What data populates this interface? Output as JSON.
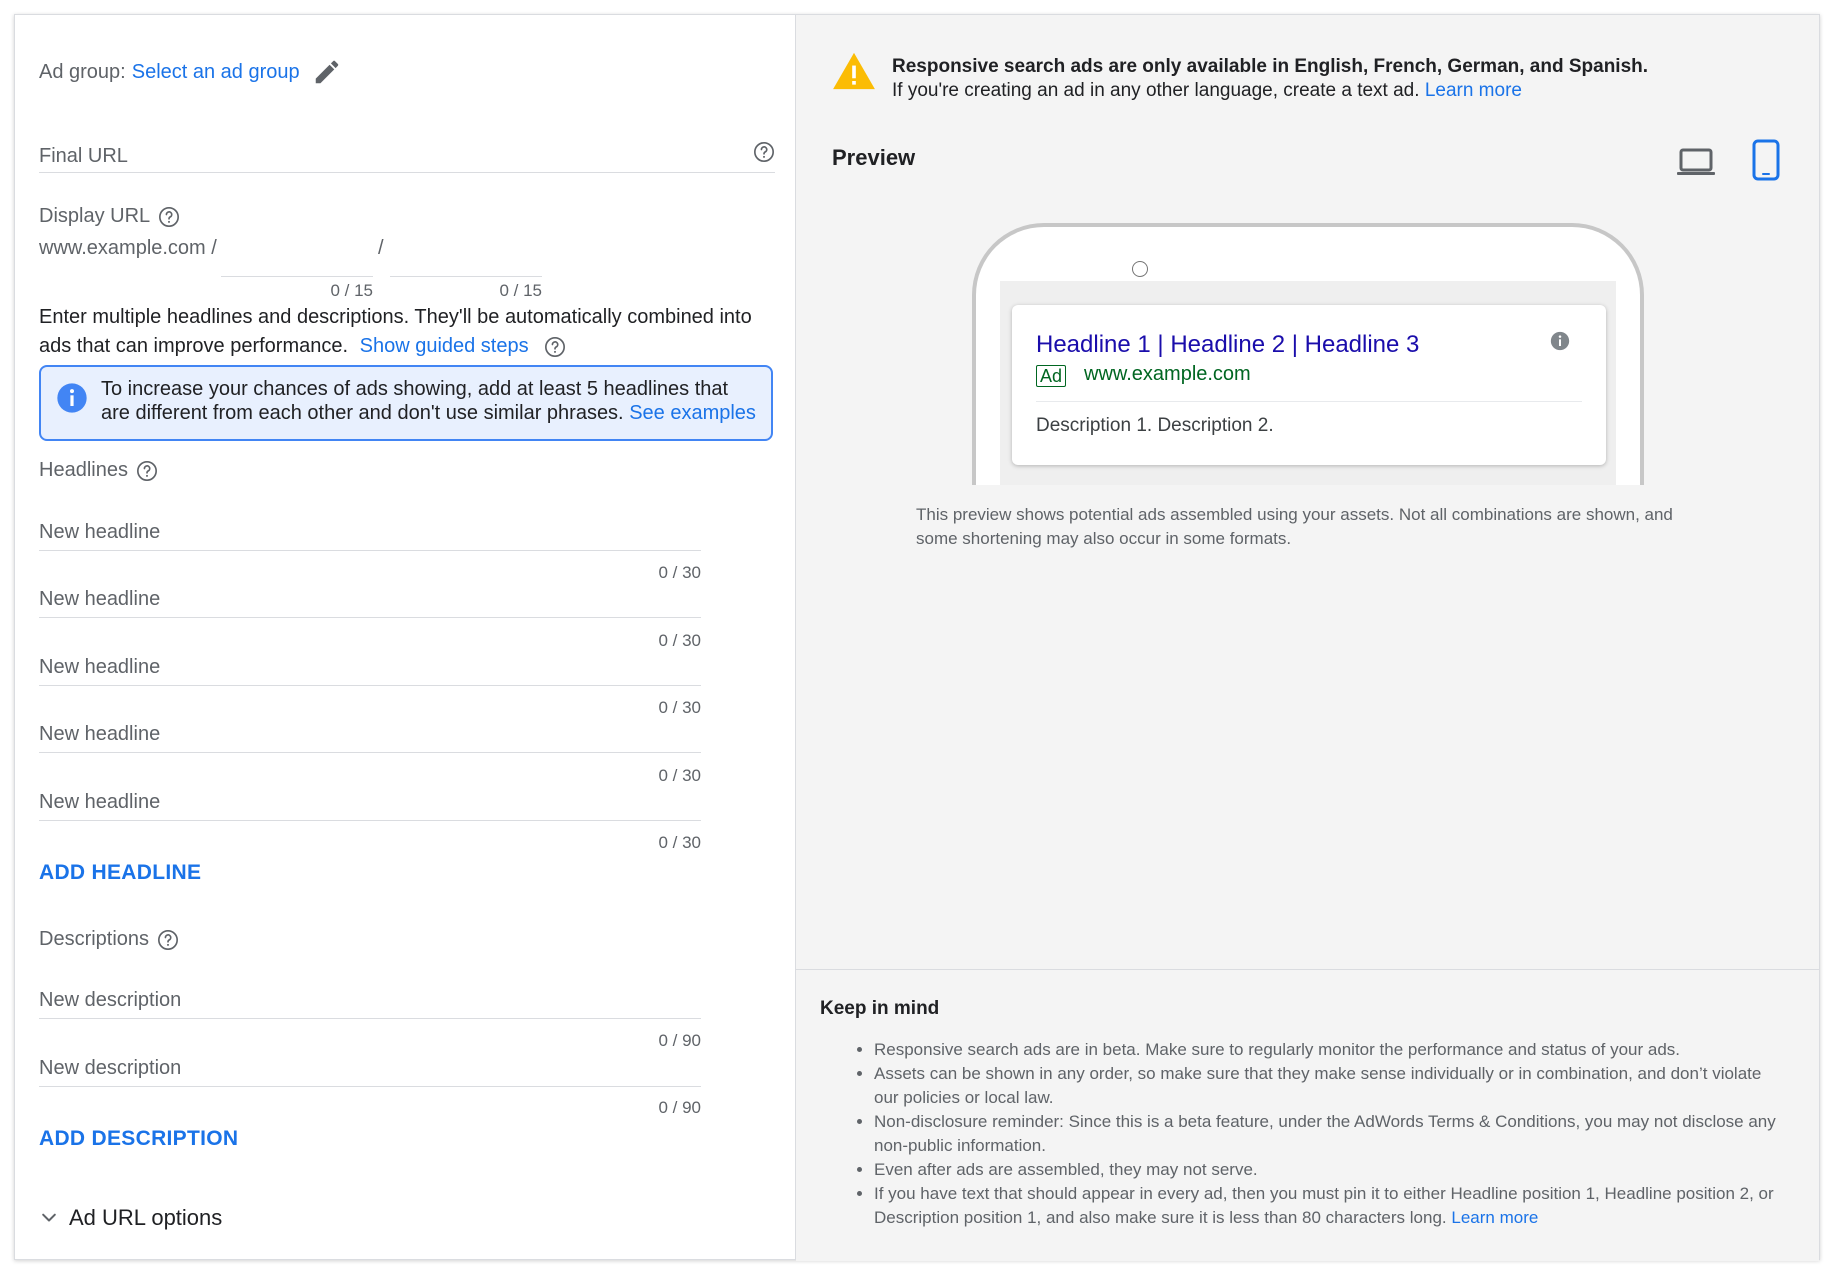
{
  "ad_group": {
    "label": "Ad group:",
    "link": "Select an ad group"
  },
  "final_url": {
    "placeholder": "Final URL"
  },
  "display_url": {
    "label": "Display URL",
    "base": "www.example.com /",
    "slash": "/",
    "path1_count": "0 / 15",
    "path2_count": "0 / 15"
  },
  "intro": {
    "text": "Enter multiple headlines and descriptions. They'll be automatically combined into ads that can improve performance.",
    "link": "Show guided steps"
  },
  "info": {
    "text": "To increase your chances of ads showing, add at least 5 headlines that are different from each other and don't use similar phrases.",
    "link": "See examples"
  },
  "headlines": {
    "label": "Headlines",
    "items": [
      {
        "placeholder": "New headline",
        "count": "0 / 30"
      },
      {
        "placeholder": "New headline",
        "count": "0 / 30"
      },
      {
        "placeholder": "New headline",
        "count": "0 / 30"
      },
      {
        "placeholder": "New headline",
        "count": "0 / 30"
      },
      {
        "placeholder": "New headline",
        "count": "0 / 30"
      }
    ],
    "add_label": "ADD HEADLINE"
  },
  "descriptions": {
    "label": "Descriptions",
    "items": [
      {
        "placeholder": "New description",
        "count": "0 / 90"
      },
      {
        "placeholder": "New description",
        "count": "0 / 90"
      }
    ],
    "add_label": "ADD DESCRIPTION"
  },
  "url_options": {
    "label": "Ad URL options"
  },
  "warning": {
    "bold": "Responsive search ads are only available in English, French, German, and Spanish.",
    "text": "If you're creating an ad in any other language, create a text ad.",
    "link": "Learn more",
    "color": "#fbbc04"
  },
  "preview": {
    "title": "Preview",
    "ad": {
      "headline": "Headline 1 | Headline 2 | Headline 3",
      "badge": "Ad",
      "url": "www.example.com",
      "description": "Description 1. Description 2."
    },
    "note": "This preview shows potential ads assembled using your assets. Not all combinations are shown, and some shortening may also occur in some formats."
  },
  "keep_in_mind": {
    "title": "Keep in mind",
    "items": [
      "Responsive search ads are in beta. Make sure to regularly monitor the performance and status of your ads.",
      "Assets can be shown in any order, so make sure that they make sense individually or in combination, and don’t violate our policies or local law.",
      "Non-disclosure reminder: Since this is a beta feature, under the AdWords Terms & Conditions, you may not disclose any non-public information.",
      "Even after ads are assembled, they may not serve.",
      "If you have text that should appear in every ad, then you must pin it to either Headline position 1, Headline position 2, or Description position 1, and also make sure it is less than 80 characters long."
    ],
    "last_link": "Learn more"
  },
  "colors": {
    "accent": "#1a73e8",
    "ad_headline": "#1a0dab",
    "ad_url": "#006621",
    "info_border": "#4285f4"
  }
}
